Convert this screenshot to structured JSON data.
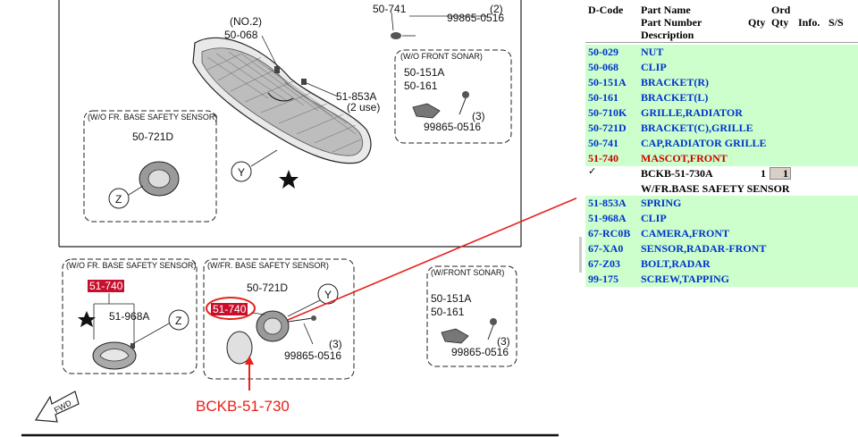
{
  "diagram": {
    "labels": {
      "no2": "(NO.2)",
      "part_50_068": "50-068",
      "part_50_741": "50-741",
      "part_99865_0516_top": "99865-0516",
      "qty2": "(2)",
      "wo_front_sonar": "(W/O FRONT SONAR)",
      "part_50_151A_a": "50-151A",
      "part_50_161_a": "50-161",
      "part_99865_0516_a": "99865-0516",
      "qty3_a": "(3)",
      "part_51_853A": "51-853A",
      "two_use": "(2 use)",
      "wo_fr_base_top": "(W/O FR. BASE SAFETY SENSOR)",
      "part_50_721D_top": "50-721D",
      "marker_y_top": "Y",
      "marker_z_top": "Z",
      "wo_fr_base_bottom": "(W/O FR. BASE SAFETY SENSOR)",
      "part_51_740_a": "51-740",
      "part_51_968A": "51-968A",
      "marker_z_bottom": "Z",
      "w_fr_base": "(W/FR. BASE SAFETY SENSOR)",
      "part_50_721D_bottom": "50-721D",
      "part_51_740_b": "51-740",
      "marker_y_bottom": "Y",
      "qty3_b": "(3)",
      "part_99865_0516_b": "99865-0516",
      "w_front_sonar": "(W/FRONT SONAR)",
      "part_50_151A_b": "50-151A",
      "part_50_161_b": "50-161",
      "qty3_c": "(3)",
      "part_99865_0516_c": "99865-0516",
      "fwd": "FWD"
    },
    "annotation": "BCKB-51-730",
    "colors": {
      "annotation": "#e8211a",
      "highlight": "#c8102e"
    }
  },
  "parts_panel": {
    "headers": {
      "dcode": "D-Code",
      "part_name": "Part Name",
      "part_number": "Part Number",
      "description": "Description",
      "qty": "Qty",
      "ord": "Ord",
      "ord2": "Qty",
      "info": "Info.",
      "ss": "S/S"
    },
    "rows": [
      {
        "code": "50-029",
        "name": "NUT"
      },
      {
        "code": "50-068",
        "name": "CLIP"
      },
      {
        "code": "50-151A",
        "name": "BRACKET(R)"
      },
      {
        "code": "50-161",
        "name": "BRACKET(L)"
      },
      {
        "code": "50-710K",
        "name": "GRILLE,RADIATOR"
      },
      {
        "code": "50-721D",
        "name": "BRACKET(C),GRILLE"
      },
      {
        "code": "50-741",
        "name": "CAP,RADIATOR GRILLE"
      },
      {
        "code": "51-740",
        "name": "MASCOT,FRONT"
      }
    ],
    "selected": {
      "check": "✓",
      "part_number": "BCKB-51-730A",
      "qty": "1",
      "ord_qty": "1",
      "description": "W/FR.BASE SAFETY SENSOR"
    },
    "rows_after": [
      {
        "code": "51-853A",
        "name": "SPRING"
      },
      {
        "code": "51-968A",
        "name": "CLIP"
      },
      {
        "code": "67-RC0B",
        "name": "CAMERA,FRONT"
      },
      {
        "code": "67-XA0",
        "name": "SENSOR,RADAR-FRONT"
      },
      {
        "code": "67-Z03",
        "name": "BOLT,RADAR"
      },
      {
        "code": "99-175",
        "name": "SCREW,TAPPING"
      }
    ],
    "colors": {
      "row_bg": "#ccffcc",
      "code_text": "#0033cc",
      "highlight_text": "#cc0000"
    }
  }
}
